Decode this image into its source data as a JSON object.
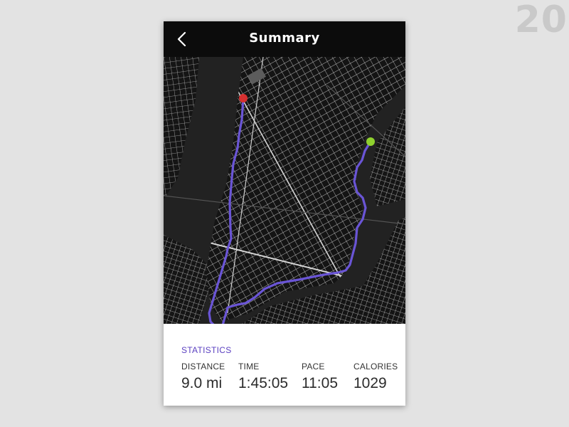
{
  "page_number": "20",
  "header": {
    "title": "Summary",
    "back_icon": "chevron-left-icon"
  },
  "map": {
    "route_color": "#6a55d6",
    "start_marker_color": "#8fd12e",
    "end_marker_color": "#d63030",
    "background_color": "#1f1f1f",
    "street_color": "#cfcfcf"
  },
  "statistics": {
    "title": "STATISTICS",
    "items": [
      {
        "label": "DISTANCE",
        "value": "9.0 mi"
      },
      {
        "label": "TIME",
        "value": "1:45:05"
      },
      {
        "label": "PACE",
        "value": "11:05"
      },
      {
        "label": "CALORIES",
        "value": "1029"
      }
    ]
  },
  "colors": {
    "accent": "#5a3fc0",
    "header_bg": "#0c0c0c",
    "page_bg": "#e3e3e3"
  }
}
